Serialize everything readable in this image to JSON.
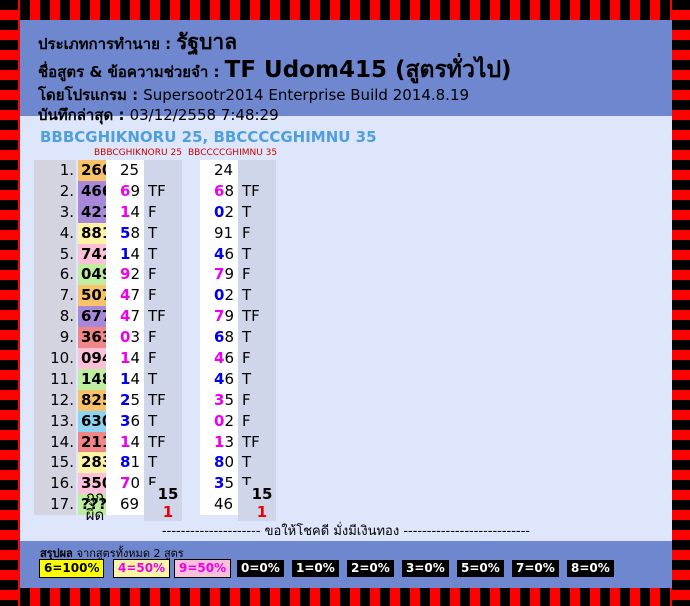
{
  "header": {
    "type_label": "ประเภทการทำนาย :",
    "type_value": "รัฐบาล",
    "formula_label": "ชื่อสูตร & ข้อความช่วยจำ :",
    "formula_value": "TF Udom415 (สูตรทั่วไป)",
    "program_label": "โดยโปรแกรม :",
    "program_value": "Supersootr2014 Enterprise Build 2014.8.19",
    "updated_label": "บันทึกล่าสุด :",
    "updated_value": "03/12/2558 7:48:29"
  },
  "formula_strings": {
    "f1": "BBBCGHIKNORU 25",
    "f2": "BBCCCCGHIMNU 35"
  },
  "columns": {
    "c1": "BBBCGHIKNORU 25",
    "c2": "BBCCCCGHIMNU 35"
  },
  "colors": {
    "draw_bg": [
      "#f7c26a",
      "#a888d8",
      "#a888d8",
      "#fff3a6",
      "#fcc0d8",
      "#bfeea0",
      "#f7c26a",
      "#a888d8",
      "#f08686",
      "#fcc0d8",
      "#bfeea0",
      "#f7c26a",
      "#8fd3f2",
      "#f08686",
      "#fff3a6",
      "#fcc0d8",
      "#bfeea0"
    ],
    "digit_blue": "#0000ee",
    "digit_magenta": "#ee00ee",
    "wrong_red": "#ee0000"
  },
  "rows": [
    {
      "idx": "1.",
      "num": "260",
      "v1": "25",
      "c1": "",
      "t1": "",
      "v2": "24",
      "c2": "",
      "t2": ""
    },
    {
      "idx": "2.",
      "num": "466",
      "v1": "69",
      "c1": "m",
      "t1": "TF",
      "v2": "68",
      "c2": "m",
      "t2": "TF"
    },
    {
      "idx": "3.",
      "num": "421",
      "v1": "14",
      "c1": "m",
      "t1": "F",
      "v2": "02",
      "c2": "b",
      "t2": "T"
    },
    {
      "idx": "4.",
      "num": "881",
      "v1": "58",
      "c1": "b",
      "t1": "T",
      "v2": "91",
      "c2": "",
      "t2": "F"
    },
    {
      "idx": "5.",
      "num": "742",
      "v1": "14",
      "c1": "b",
      "t1": "T",
      "v2": "46",
      "c2": "b",
      "t2": "T"
    },
    {
      "idx": "6.",
      "num": "049",
      "v1": "92",
      "c1": "m",
      "t1": "F",
      "v2": "79",
      "c2": "m",
      "t2": "F"
    },
    {
      "idx": "7.",
      "num": "507",
      "v1": "47",
      "c1": "m",
      "t1": "F",
      "v2": "02",
      "c2": "b",
      "t2": "T"
    },
    {
      "idx": "8.",
      "num": "677",
      "v1": "47",
      "c1": "m",
      "t1": "TF",
      "v2": "79",
      "c2": "m",
      "t2": "TF"
    },
    {
      "idx": "9.",
      "num": "363",
      "v1": "03",
      "c1": "m",
      "t1": "F",
      "v2": "68",
      "c2": "b",
      "t2": "T"
    },
    {
      "idx": "10.",
      "num": "094",
      "v1": "14",
      "c1": "m",
      "t1": "F",
      "v2": "46",
      "c2": "m",
      "t2": "F"
    },
    {
      "idx": "11.",
      "num": "148",
      "v1": "14",
      "c1": "b",
      "t1": "T",
      "v2": "46",
      "c2": "b",
      "t2": "T"
    },
    {
      "idx": "12.",
      "num": "825",
      "v1": "25",
      "c1": "b",
      "t1": "TF",
      "v2": "35",
      "c2": "m",
      "t2": "F"
    },
    {
      "idx": "13.",
      "num": "630",
      "v1": "36",
      "c1": "b",
      "t1": "T",
      "v2": "02",
      "c2": "m",
      "t2": "F"
    },
    {
      "idx": "14.",
      "num": "211",
      "v1": "14",
      "c1": "m",
      "t1": "TF",
      "v2": "13",
      "c2": "m",
      "t2": "TF"
    },
    {
      "idx": "15.",
      "num": "283",
      "v1": "81",
      "c1": "b",
      "t1": "T",
      "v2": "80",
      "c2": "b",
      "t2": "T"
    },
    {
      "idx": "16.",
      "num": "350",
      "v1": "70",
      "c1": "m",
      "t1": "F",
      "v2": "35",
      "c2": "b",
      "t2": "T"
    },
    {
      "idx": "17.",
      "num": "???",
      "v1": "69",
      "c1": "",
      "t1": "",
      "v2": "46",
      "c2": "",
      "t2": ""
    }
  ],
  "summary": {
    "correct_label": "ถูก",
    "wrong_label": "ผิด",
    "correct1": "15",
    "wrong1": "1",
    "correct2": "15",
    "wrong2": "1"
  },
  "divider_text": "--------------------- ขอให้โชคดี มั่งมีเงินทอง ---------------------------",
  "footer": {
    "title_bold": "สรุปผล",
    "title_light": "จากสูตรทั้งหมด 2 สูตร",
    "badges": [
      "6=100%",
      "4=50%",
      "9=50%",
      "0=0%",
      "1=0%",
      "2=0%",
      "3=0%",
      "5=0%",
      "7=0%",
      "8=0%"
    ],
    "badge_styles": [
      {
        "bg": "#ffff00",
        "fg": "#000000"
      },
      {
        "bg": "#fff3a6",
        "fg": "#ee00ee"
      },
      {
        "bg": "#fcc0d8",
        "fg": "#ee00ee"
      },
      {
        "bg": "#000000",
        "fg": "#ffffff"
      },
      {
        "bg": "#000000",
        "fg": "#ffffff"
      },
      {
        "bg": "#000000",
        "fg": "#ffffff"
      },
      {
        "bg": "#000000",
        "fg": "#ffffff"
      },
      {
        "bg": "#000000",
        "fg": "#ffffff"
      },
      {
        "bg": "#000000",
        "fg": "#ffffff"
      },
      {
        "bg": "#000000",
        "fg": "#ffffff"
      }
    ]
  }
}
